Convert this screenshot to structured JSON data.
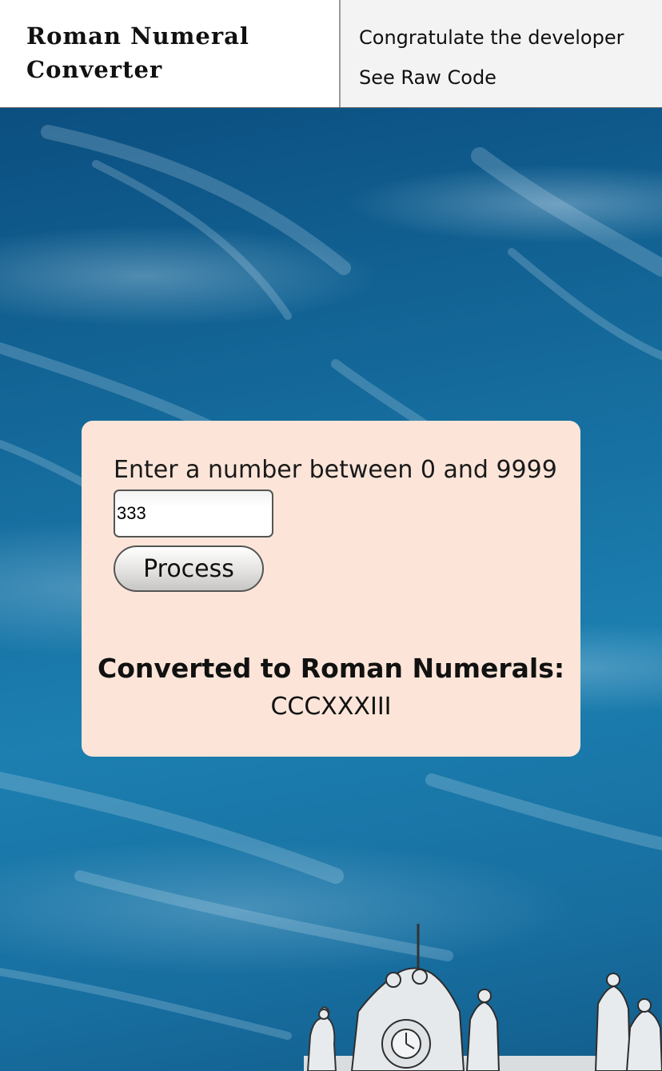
{
  "header": {
    "title": "Roman Numeral Converter",
    "nav": [
      {
        "label": "Congratulate the developer"
      },
      {
        "label": "See Raw Code"
      }
    ]
  },
  "converter": {
    "prompt": "Enter a number between 0 and 9999",
    "input_value": "333",
    "button_label": "Process",
    "result_heading": "Converted to Roman Numerals:",
    "result_value": "CCCXXXIII"
  },
  "colors": {
    "card_background": "#fce5d8",
    "sky": "#1a6f9c",
    "header_nav_background": "#f3f3f3"
  }
}
